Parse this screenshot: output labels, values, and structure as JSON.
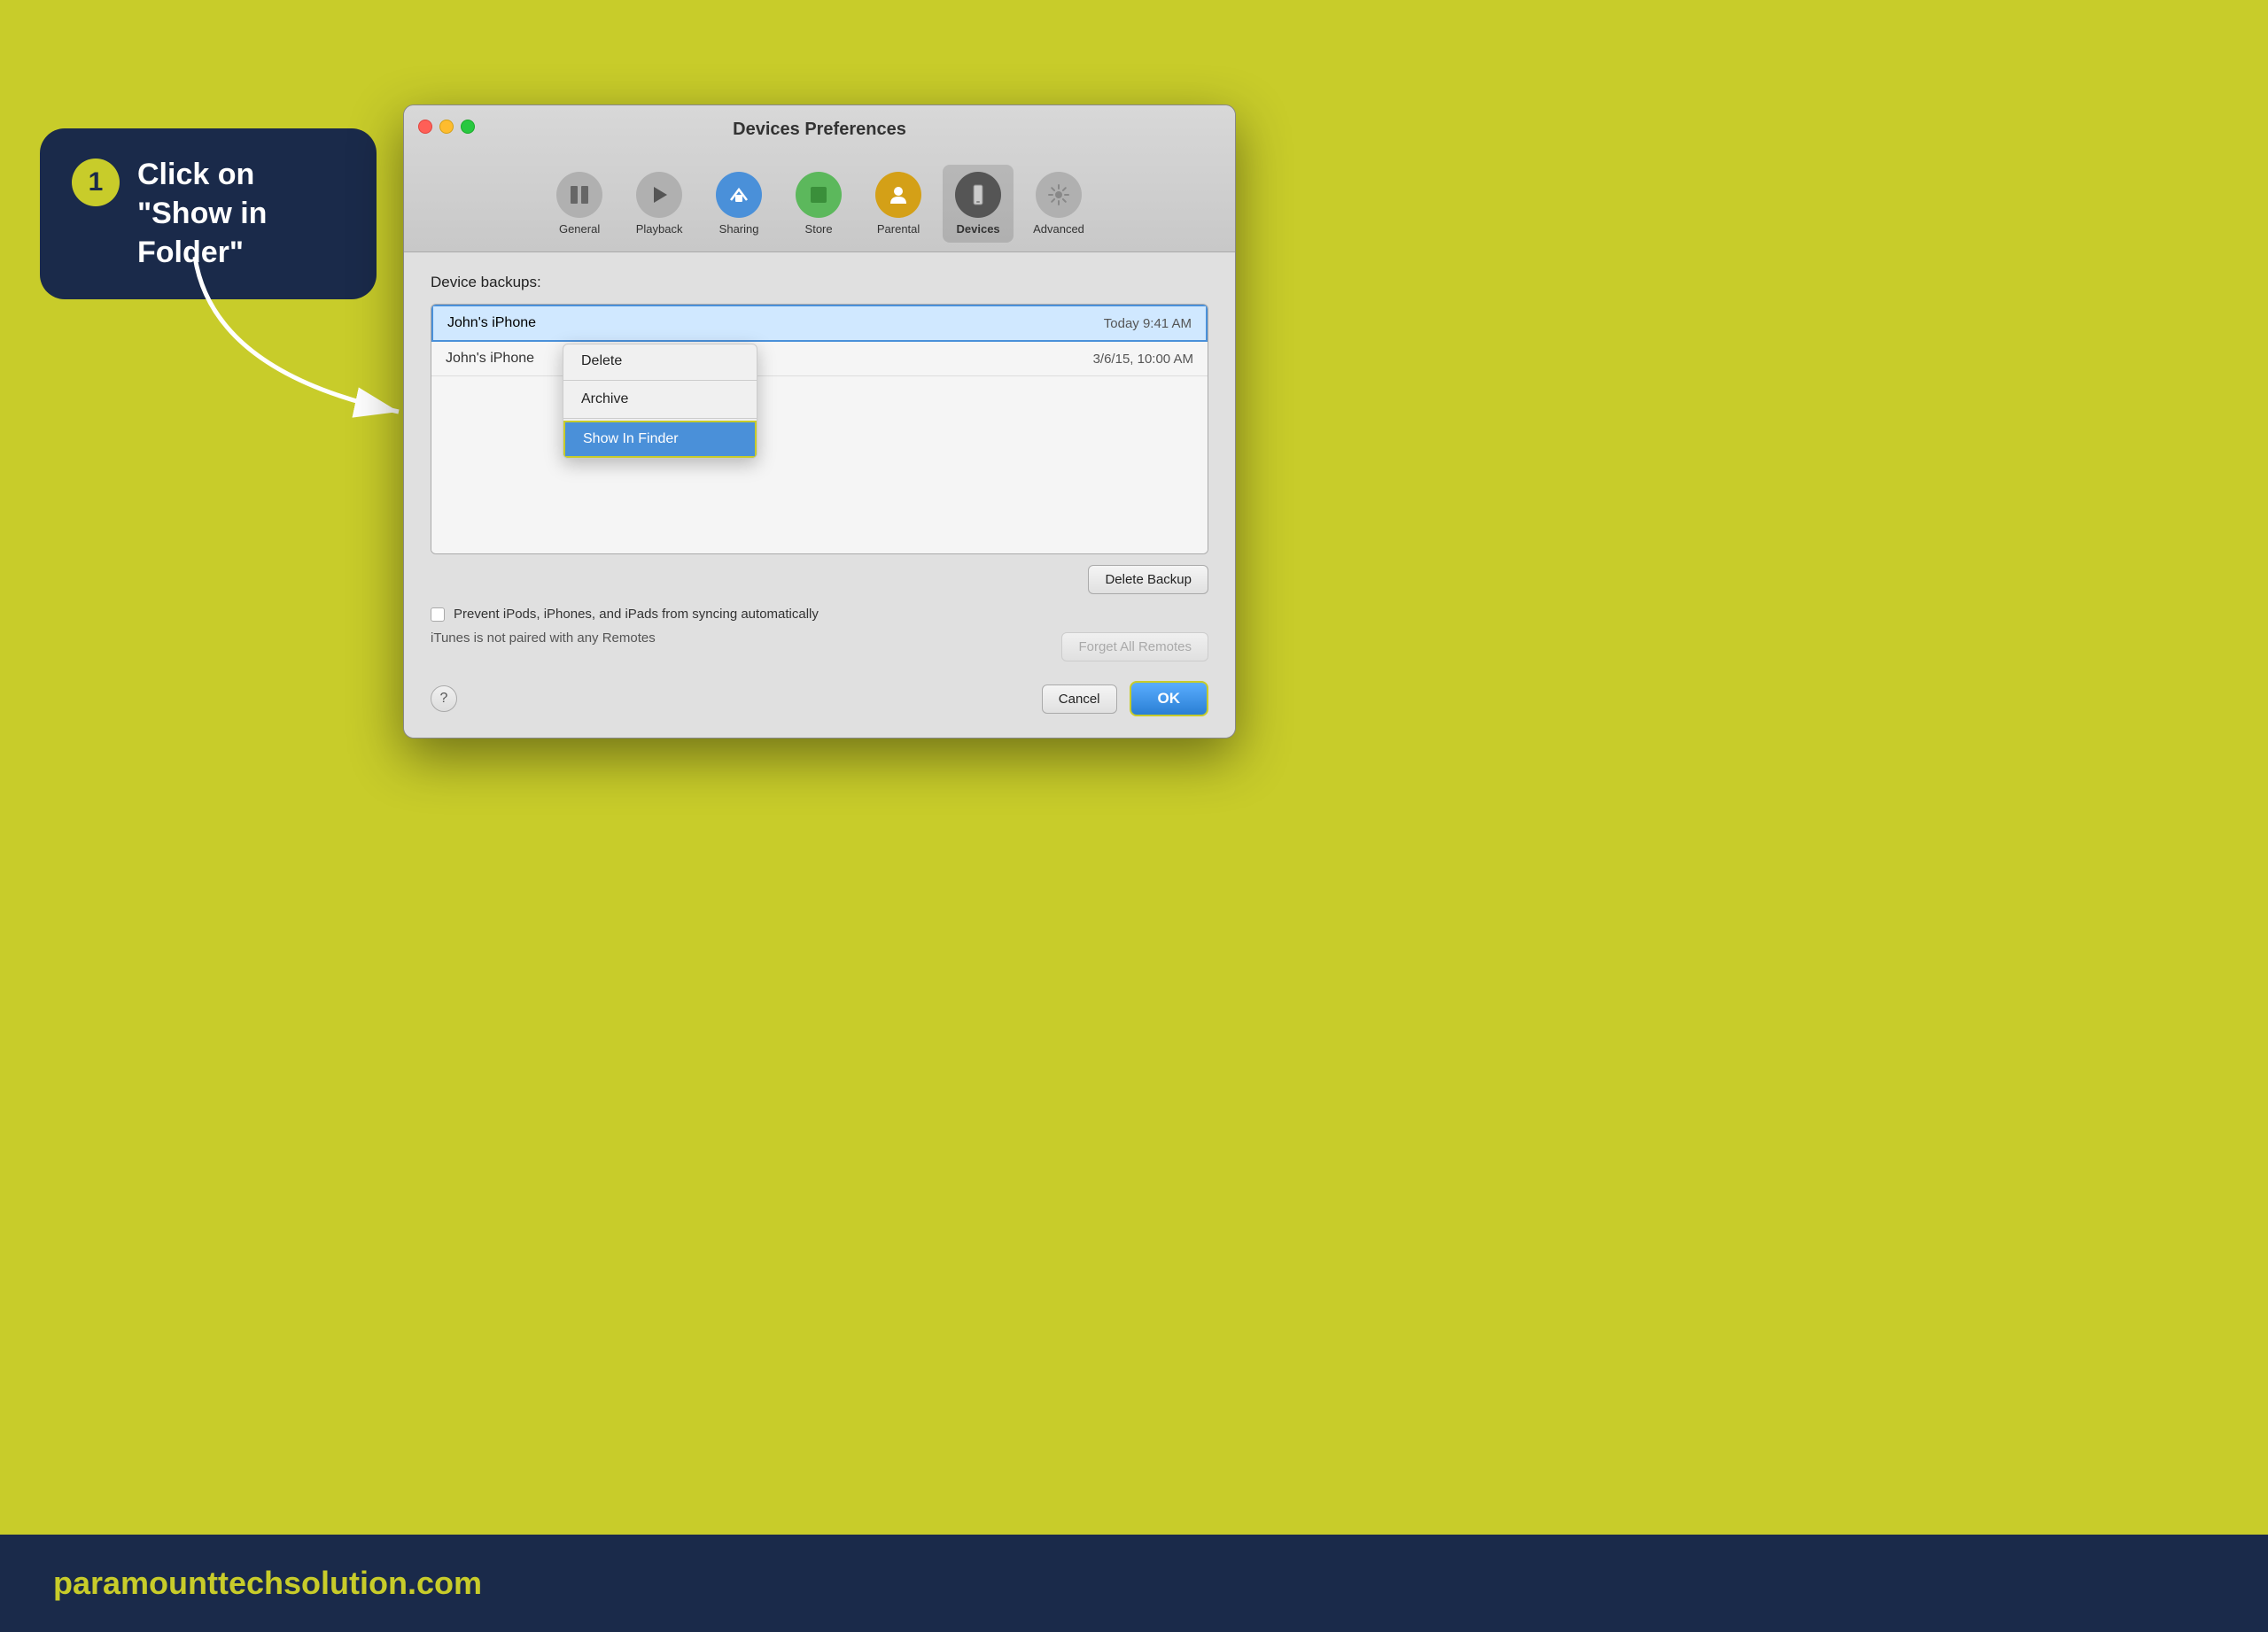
{
  "background_color": "#c8cc2a",
  "bottom_bar": {
    "background": "#1a2a4a",
    "website": "paramounttechsolution.com"
  },
  "callout": {
    "step_number": "1",
    "text_line1": "Click on",
    "text_line2": "\"Show in Folder\""
  },
  "dialog": {
    "title": "Devices Preferences",
    "toolbar": {
      "items": [
        {
          "id": "general",
          "label": "General",
          "icon": "⊟",
          "active": false
        },
        {
          "id": "playback",
          "label": "Playback",
          "icon": "▶",
          "active": false
        },
        {
          "id": "sharing",
          "label": "Sharing",
          "icon": "♪",
          "active": false
        },
        {
          "id": "store",
          "label": "Store",
          "icon": "■",
          "active": false
        },
        {
          "id": "parental",
          "label": "Parental",
          "icon": "👤",
          "active": false
        },
        {
          "id": "devices",
          "label": "Devices",
          "icon": "📱",
          "active": true
        },
        {
          "id": "advanced",
          "label": "Advanced",
          "icon": "⚙",
          "active": false
        }
      ]
    },
    "section_label": "Device backups:",
    "backups": [
      {
        "name": "John's iPhone",
        "date": "Today 9:41 AM",
        "selected": true
      },
      {
        "name": "John's iPhone",
        "date": "3/6/15, 10:00 AM",
        "selected": false
      }
    ],
    "context_menu": {
      "items": [
        {
          "label": "Delete",
          "highlighted": false
        },
        {
          "label": "Archive",
          "highlighted": false
        },
        {
          "label": "Show In Finder",
          "highlighted": true
        }
      ]
    },
    "delete_backup_button": "Delete Backup",
    "checkbox_label": "Prevent iPods, iPhones, and iPads from syncing automatically",
    "info_text": "iTunes is not paired with any Remotes",
    "forget_remotes_button": "Forget All Remotes",
    "help_button": "?",
    "cancel_button": "Cancel",
    "ok_button": "OK"
  }
}
